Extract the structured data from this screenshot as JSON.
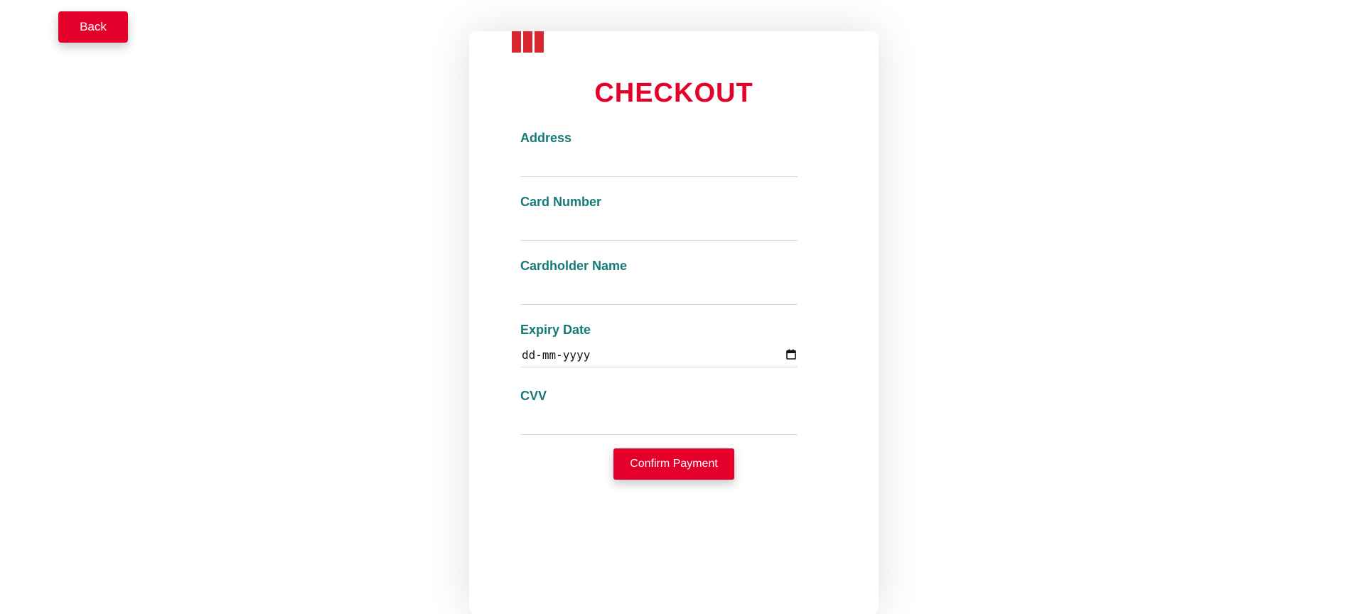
{
  "back_button": {
    "label": "Back"
  },
  "checkout": {
    "logo_icon": "kfc-stripes-logo",
    "title": "CHECKOUT",
    "fields": {
      "address": {
        "label": "Address",
        "value": ""
      },
      "card_number": {
        "label": "Card Number",
        "value": ""
      },
      "cardholder_name": {
        "label": "Cardholder Name",
        "value": ""
      },
      "expiry_date": {
        "label": "Expiry Date",
        "placeholder": "dd-mm-yyyy",
        "icon": "calendar-icon"
      },
      "cvv": {
        "label": "CVV",
        "value": ""
      }
    },
    "confirm_label": "Confirm Payment"
  },
  "colors": {
    "accent": "#e4002b",
    "label": "#167a7a",
    "logo": "#d7282f"
  }
}
